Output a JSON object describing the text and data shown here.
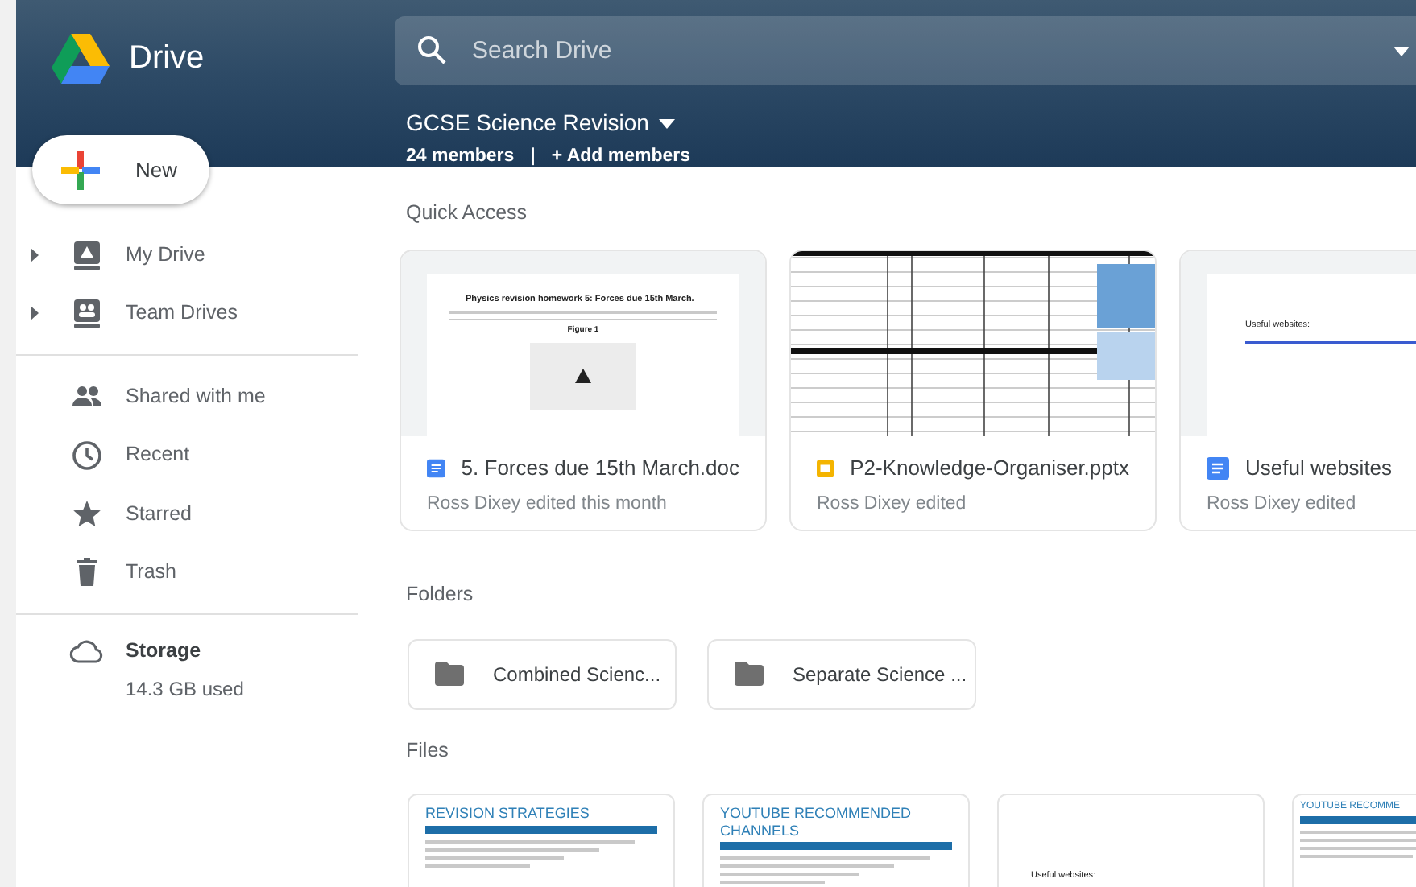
{
  "app": {
    "name": "Drive"
  },
  "search": {
    "placeholder": "Search Drive"
  },
  "team_drive": {
    "title": "GCSE Science Revision",
    "members": "24 members",
    "separator": "|",
    "add_members": "+ Add members"
  },
  "new_button": {
    "label": "New"
  },
  "nav": [
    {
      "label": "My Drive",
      "expandable": true
    },
    {
      "label": "Team Drives",
      "expandable": true
    },
    {
      "label": "Shared with me",
      "expandable": false
    },
    {
      "label": "Recent",
      "expandable": false
    },
    {
      "label": "Starred",
      "expandable": false
    },
    {
      "label": "Trash",
      "expandable": false
    }
  ],
  "storage": {
    "label": "Storage",
    "used": "14.3 GB used"
  },
  "quick_access": {
    "heading": "Quick Access",
    "items": [
      {
        "title": "5. Forces due 15th March.doc",
        "kind": "doc",
        "subtitle": "Ross Dixey edited this month",
        "thumbnail": {
          "kind": "figure",
          "heading": "Physics revision homework 5: Forces due 15th March.",
          "caption": "Figure 1"
        }
      },
      {
        "title": "P2-Knowledge-Organiser.pptx",
        "kind": "slides",
        "subtitle": "Ross Dixey edited",
        "thumbnail": {
          "kind": "grid"
        }
      },
      {
        "title": "Useful websites",
        "kind": "doc",
        "subtitle": "Ross Dixey edited",
        "thumbnail": {
          "kind": "links",
          "heading": "Useful websites:"
        }
      }
    ]
  },
  "folders": {
    "heading": "Folders",
    "items": [
      {
        "name": "Combined Scienc..."
      },
      {
        "name": "Separate Science ..."
      }
    ]
  },
  "files": {
    "heading": "Files",
    "items": [
      {
        "thumbnail": {
          "kind": "banner",
          "heading": "REVISION STRATEGIES"
        }
      },
      {
        "thumbnail": {
          "kind": "banner",
          "heading": "YOUTUBE RECOMMENDED CHANNELS"
        }
      },
      {
        "thumbnail": {
          "kind": "links",
          "heading": "Useful websites:"
        }
      },
      {
        "thumbnail": {
          "kind": "banner",
          "heading": "YOUTUBE RECOMME"
        }
      }
    ]
  }
}
